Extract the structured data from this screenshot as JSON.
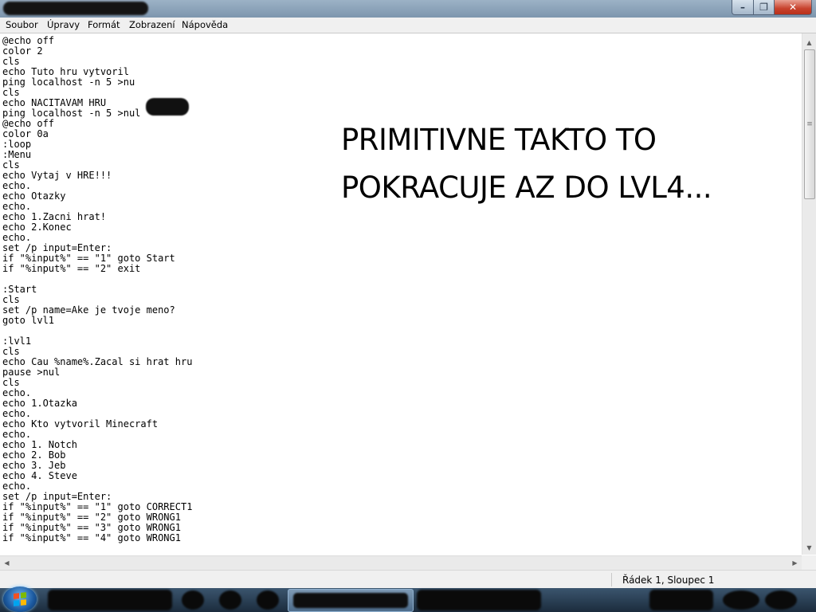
{
  "window": {
    "controls": {
      "minimize": "–",
      "maximize": "❐",
      "close": "✕"
    }
  },
  "menu": [
    "Soubor",
    "Úpravy",
    "Formát",
    "Zobrazení",
    "Nápověda"
  ],
  "editor": {
    "lines": [
      "@echo off",
      "color 2",
      "cls",
      "echo Tuto hru vytvoril",
      "ping localhost -n 5 >nu",
      "cls",
      "echo NACITAVAM HRU",
      "ping localhost -n 5 >nul",
      "@echo off",
      "color 0a",
      ":loop",
      ":Menu",
      "cls",
      "echo Vytaj v HRE!!!",
      "echo.",
      "echo Otazky",
      "echo.",
      "echo 1.Zacni hrat!",
      "echo 2.Konec",
      "echo.",
      "set /p input=Enter:",
      "if \"%input%\" == \"1\" goto Start",
      "if \"%input%\" == \"2\" exit",
      "",
      ":Start",
      "cls",
      "set /p name=Ake je tvoje meno?",
      "goto lvl1",
      "",
      ":lvl1",
      "cls",
      "echo Cau %name%.Zacal si hrat hru",
      "pause >nul",
      "cls",
      "echo.",
      "echo 1.Otazka",
      "echo.",
      "echo Kto vytvoril Minecraft",
      "echo.",
      "echo 1. Notch",
      "echo 2. Bob",
      "echo 3. Jeb",
      "echo 4. Steve",
      "echo.",
      "set /p input=Enter:",
      "if \"%input%\" == \"1\" goto CORRECT1",
      "if \"%input%\" == \"2\" goto WRONG1",
      "if \"%input%\" == \"3\" goto WRONG1",
      "if \"%input%\" == \"4\" goto WRONG1"
    ],
    "annotation": [
      "PRIMITIVNE TAKTO TO",
      "POKRACUJE AZ DO LVL4..."
    ]
  },
  "scrollbars": {
    "up": "▲",
    "down": "▼",
    "left": "◀",
    "right": "▶",
    "grip": "≡"
  },
  "status": {
    "position": "Řádek 1, Sloupec 1"
  },
  "colors": {
    "accent_close": "#c7412c",
    "taskbar": "#1b2c3d"
  },
  "icons": [
    "windows-start-icon"
  ]
}
